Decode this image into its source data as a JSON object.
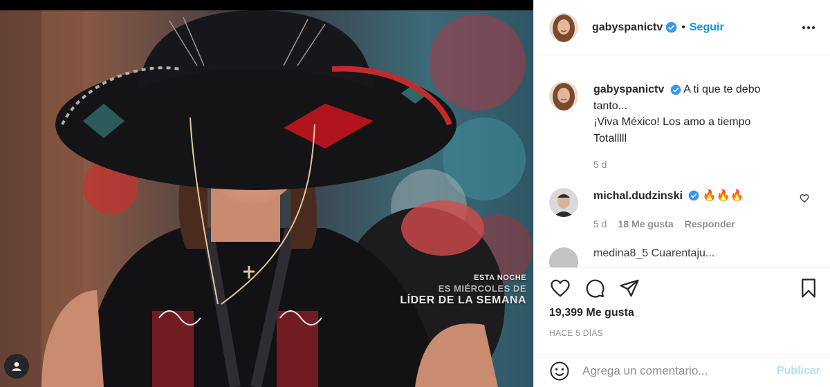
{
  "post": {
    "overlay": {
      "line1": "ESTA NOCHE",
      "line2": "ES MIÉRCOLES DE",
      "line3": "LÍDER DE LA SEMANA"
    }
  },
  "header": {
    "username": "gabyspanictv",
    "separator": "•",
    "follow_label": "Seguir"
  },
  "caption": {
    "username": "gabyspanictv",
    "line1": "A ti que te debo",
    "line2": "tanto...",
    "line3": "¡Viva México! Los amo a tiempo",
    "line4": "Totalllll",
    "time": "5 d"
  },
  "comments": [
    {
      "username": "michal.dudzinski",
      "text": "🔥🔥🔥",
      "time": "5 d",
      "likes": "18 Me gusta",
      "reply_label": "Responder"
    }
  ],
  "next_comment_peek": "medina8_5 Cuarentaju...",
  "engagement": {
    "likes": "19,399 Me gusta",
    "age": "HACE 5 DÍAS"
  },
  "composer": {
    "placeholder": "Agrega un comentario...",
    "publish_label": "Publicar"
  },
  "colors": {
    "accent": "#0095f6",
    "publish_disabled": "#b2dffc",
    "muted": "#8e8e8e",
    "text": "#262626"
  },
  "icons": [
    "verified-badge-icon",
    "more-options-icon",
    "heart-icon",
    "comment-icon",
    "share-icon",
    "bookmark-icon",
    "emoji-icon",
    "user-tag-icon"
  ]
}
